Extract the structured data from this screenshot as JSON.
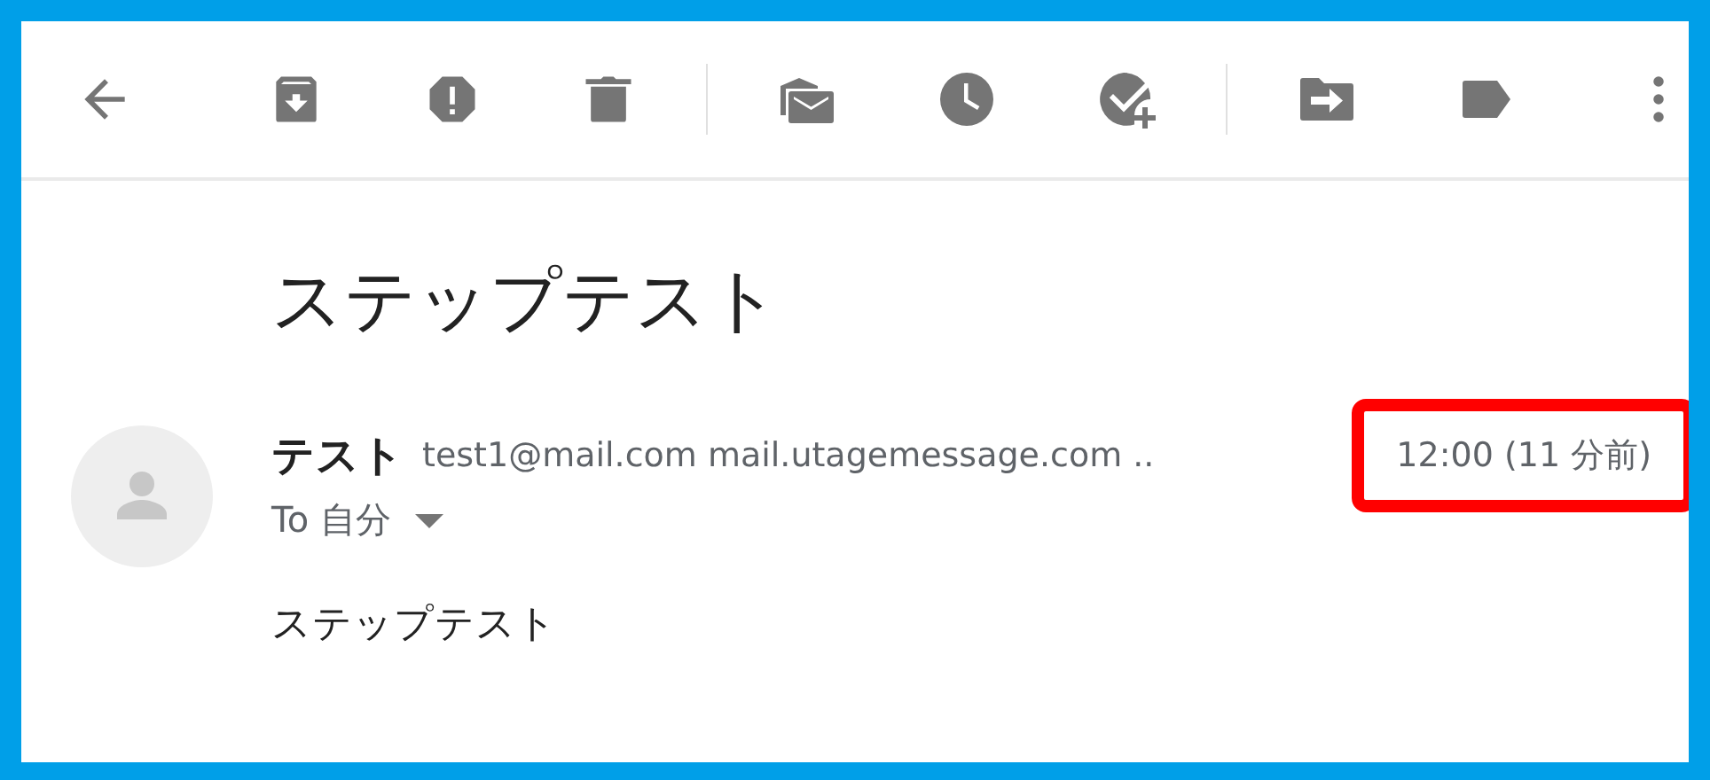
{
  "subject": "ステップテスト",
  "sender": {
    "name": "テスト",
    "address": "test1@mail.com mail.utagemessage.com ..",
    "recipient": "To 自分"
  },
  "time": {
    "text": "12:00 (11 分前)",
    "highlighted": true
  },
  "body": "ステップテスト"
}
